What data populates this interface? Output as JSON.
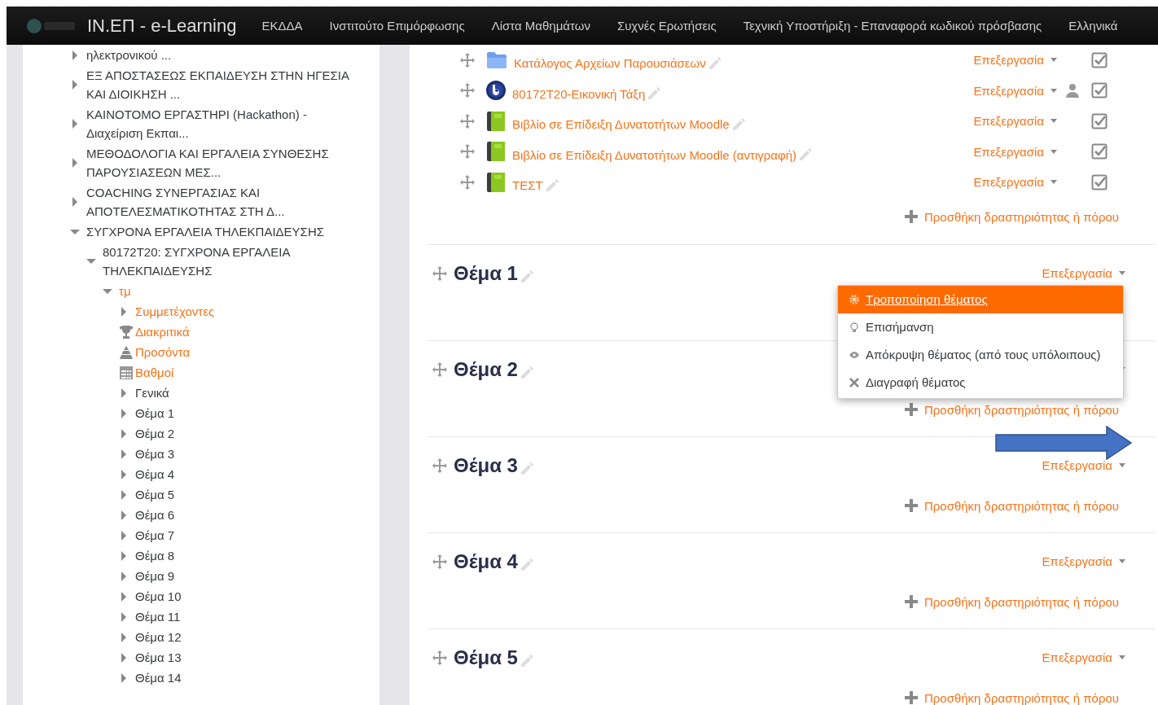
{
  "navbar": {
    "brand": "ΙΝ.ΕΠ - e-Learning",
    "items": [
      "ΕΚΔΔΑ",
      "Ινστιτούτο Επιμόρφωσης",
      "Λίστα Μαθημάτων",
      "Συχνές Ερωτήσεις",
      "Τεχνική Υποστήριξη - Επαναφορά κωδικού πρόσβασης",
      "Ελληνικά"
    ]
  },
  "sidebar": {
    "tree": [
      {
        "label": "ηλεκτρονικού ...",
        "kind": "branch",
        "link": false,
        "expanded": false
      },
      {
        "label": "ΕΞ ΑΠΟΣΤΑΣΕΩΣ ΕΚΠΑΙΔΕΥΣΗ ΣΤΗΝ ΗΓΕΣΙΑ ΚΑΙ ΔΙΟΙΚΗΣΗ ...",
        "kind": "branch",
        "link": false,
        "expanded": false
      },
      {
        "label": "ΚΑΙΝΟΤΟΜΟ ΕΡΓΑΣΤΗΡΙ (Hackathon) - Διαχείριση Εκπαι...",
        "kind": "branch",
        "link": false,
        "expanded": false
      },
      {
        "label": "ΜΕΘΟΔΟΛΟΓΙΑ ΚΑΙ ΕΡΓΑΛΕΙΑ ΣΥΝΘΕΣΗΣ ΠΑΡΟΥΣΙΑΣΕΩΝ ΜΕΣ...",
        "kind": "branch",
        "link": false,
        "expanded": false
      },
      {
        "label": "COACHING ΣΥΝΕΡΓΑΣΙΑΣ ΚΑΙ ΑΠΟΤΕΛΕΣΜΑΤΙΚΟΤΗΤΑΣ ΣΤΗ Δ...",
        "kind": "branch",
        "link": false,
        "expanded": false
      },
      {
        "label": "ΣΥΓΧΡΟΝΑ ΕΡΓΑΛΕΙΑ ΤΗΛΕΚΠΑΙΔΕΥΣΗΣ",
        "kind": "branch",
        "link": false,
        "expanded": true,
        "children": [
          {
            "label": "80172T20: ΣΥΓΧΡΟΝΑ ΕΡΓΑΛΕΙΑ ΤΗΛΕΚΠΑΙΔΕΥΣΗΣ",
            "kind": "branch",
            "link": false,
            "expanded": true,
            "children": [
              {
                "label": "τμ",
                "kind": "branch",
                "link": true,
                "expanded": true,
                "children": [
                  {
                    "label": "Συμμετέχοντες",
                    "kind": "branch",
                    "link": true,
                    "expanded": false
                  },
                  {
                    "label": "Διακριτικά",
                    "kind": "badges",
                    "link": true
                  },
                  {
                    "label": "Προσόντα",
                    "kind": "competencies",
                    "link": true
                  },
                  {
                    "label": "Βαθμοί",
                    "kind": "grades",
                    "link": true
                  },
                  {
                    "label": "Γενικά",
                    "kind": "branch",
                    "link": false,
                    "expanded": false
                  },
                  {
                    "label": "Θέμα 1",
                    "kind": "branch",
                    "link": false,
                    "expanded": false
                  },
                  {
                    "label": "Θέμα 2",
                    "kind": "branch",
                    "link": false,
                    "expanded": false
                  },
                  {
                    "label": "Θέμα 3",
                    "kind": "branch",
                    "link": false,
                    "expanded": false
                  },
                  {
                    "label": "Θέμα 4",
                    "kind": "branch",
                    "link": false,
                    "expanded": false
                  },
                  {
                    "label": "Θέμα 5",
                    "kind": "branch",
                    "link": false,
                    "expanded": false
                  },
                  {
                    "label": "Θέμα 6",
                    "kind": "branch",
                    "link": false,
                    "expanded": false
                  },
                  {
                    "label": "Θέμα 7",
                    "kind": "branch",
                    "link": false,
                    "expanded": false
                  },
                  {
                    "label": "Θέμα 8",
                    "kind": "branch",
                    "link": false,
                    "expanded": false
                  },
                  {
                    "label": "Θέμα 9",
                    "kind": "branch",
                    "link": false,
                    "expanded": false
                  },
                  {
                    "label": "Θέμα 10",
                    "kind": "branch",
                    "link": false,
                    "expanded": false
                  },
                  {
                    "label": "Θέμα 11",
                    "kind": "branch",
                    "link": false,
                    "expanded": false
                  },
                  {
                    "label": "Θέμα 12",
                    "kind": "branch",
                    "link": false,
                    "expanded": false
                  },
                  {
                    "label": "Θέμα 13",
                    "kind": "branch",
                    "link": false,
                    "expanded": false
                  },
                  {
                    "label": "Θέμα 14",
                    "kind": "branch",
                    "link": false,
                    "expanded": false
                  }
                ]
              }
            ]
          }
        ]
      }
    ]
  },
  "course": {
    "activities": [
      {
        "kind": "folder",
        "name": "Κατάλογος Αρχείων Παρουσιάσεων",
        "edit": "Επεξεργασία",
        "groups": false,
        "checked": true
      },
      {
        "kind": "bigbluebutton",
        "name": "80172T20-Εικονική Τάξη",
        "edit": "Επεξεργασία",
        "groups": true,
        "checked": true
      },
      {
        "kind": "book",
        "name": "Βιβλίο σε Επίδειξη Δυνατοτήτων Moodle",
        "edit": "Επεξεργασία",
        "groups": false,
        "checked": true
      },
      {
        "kind": "book",
        "name": "Βιβλίο σε Επίδειξη Δυνατοτήτων Moodle (αντιγραφή)",
        "edit": "Επεξεργασία",
        "groups": false,
        "checked": true
      },
      {
        "kind": "book",
        "name": "ΤΕΣΤ",
        "edit": "Επεξεργασία",
        "groups": false,
        "checked": true
      }
    ],
    "add_label": "Προσθήκη δραστηριότητας ή πόρου"
  },
  "sections": [
    {
      "title": "Θέμα 1",
      "edit": "Επεξεργασία",
      "menu": [
        {
          "kind": "gear",
          "label": "Τροποποίηση θέματος",
          "selected": true
        },
        {
          "kind": "bulb",
          "label": "Επισήμανση",
          "selected": false
        },
        {
          "kind": "eye",
          "label": "Απόκρυψη θέματος (από τους υπόλοιπους)",
          "selected": false
        },
        {
          "kind": "cross",
          "label": "Διαγραφή θέματος",
          "selected": false
        }
      ]
    },
    {
      "title": "Θέμα 2",
      "add_label": "Προσθήκη δραστηριότητας ή πόρου"
    },
    {
      "title": "Θέμα 3",
      "edit": "Επεξεργασία",
      "add_label": "Προσθήκη δραστηριότητας ή πόρου"
    },
    {
      "title": "Θέμα 4",
      "edit": "Επεξεργασία",
      "add_label": "Προσθήκη δραστηριότητας ή πόρου"
    },
    {
      "title": "Θέμα 5",
      "edit": "Επεξεργασία",
      "add_label": "Προσθήκη δραστηριότητας ή πόρου"
    }
  ]
}
